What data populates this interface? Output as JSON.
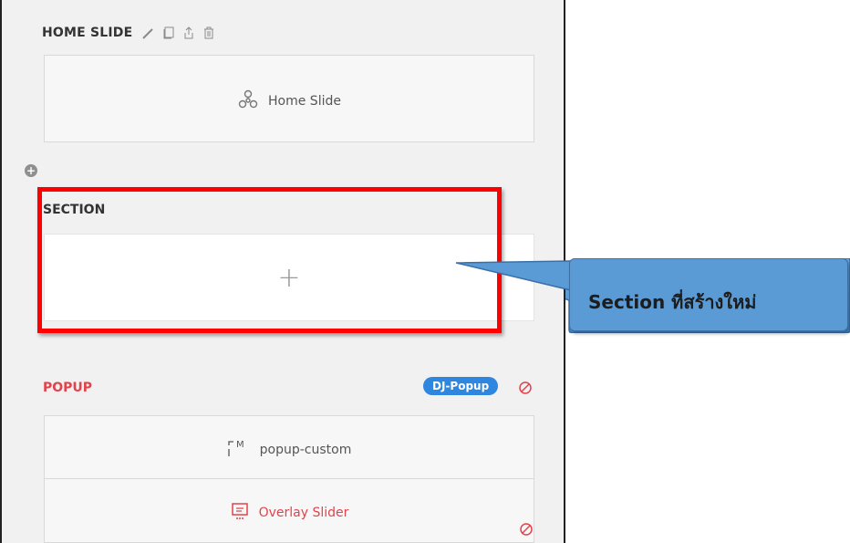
{
  "home_slide": {
    "title": "HOME SLIDE",
    "label": "Home Slide",
    "tools": [
      "pencil-icon",
      "copy-icon",
      "export-icon",
      "trash-icon"
    ]
  },
  "section": {
    "title": "SECTION",
    "placeholder_glyph": "+"
  },
  "popup": {
    "title": "POPUP",
    "badge": "DJ-Popup",
    "items": [
      {
        "label": "popup-custom",
        "icon": "module-icon"
      },
      {
        "label": "Overlay Slider",
        "icon": "slider-icon"
      }
    ]
  },
  "callout": {
    "text": "Section ที่สร้างใหม่"
  },
  "colors": {
    "panel_bg": "#f1f1f1",
    "highlight_red": "#ff0000",
    "popup_red": "#e2434b",
    "badge_blue": "#2e86de",
    "callout_blue": "#5b9bd5"
  }
}
